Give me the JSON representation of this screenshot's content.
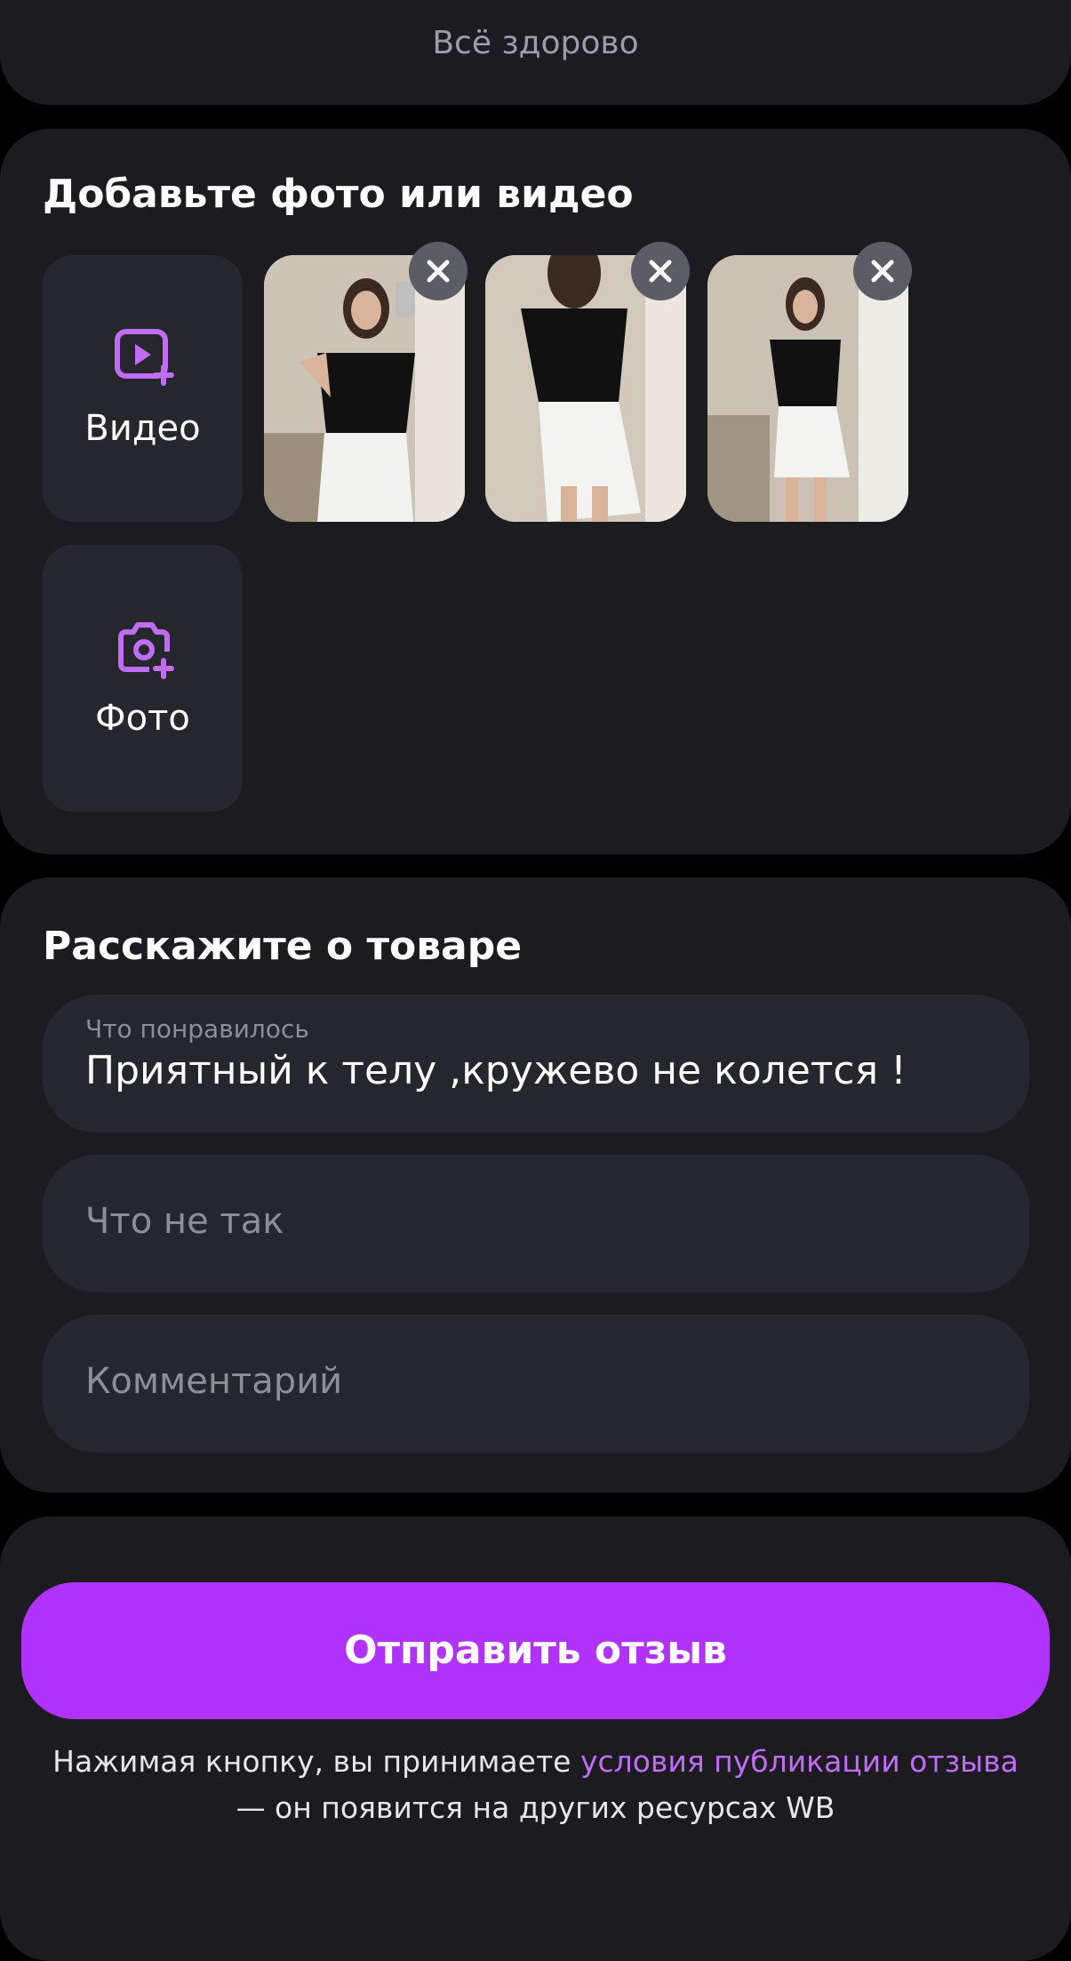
{
  "top_card": {
    "text": "Всё здорово"
  },
  "media_section": {
    "title": "Добавьте фото или видео",
    "add_video_label": "Видео",
    "add_photo_label": "Фото",
    "photos": [
      {
        "alt": "photo-1"
      },
      {
        "alt": "photo-2"
      },
      {
        "alt": "photo-3"
      }
    ]
  },
  "review_section": {
    "title": "Расскажите о товаре",
    "liked_label": "Что понравилось",
    "liked_value": "Приятный к телу ,кружево не колется !",
    "wrong_placeholder": "Что не так",
    "comment_placeholder": "Комментарий"
  },
  "submit": {
    "label": "Отправить отзыв"
  },
  "disclaimer": {
    "prefix": "Нажимая кнопку, вы принимаете ",
    "link": "условия публикации отзыва",
    "suffix": "— он появится на других ресурсах WB"
  },
  "colors": {
    "accent": "#b133fb",
    "link": "#c06cf5",
    "card": "#1b1b20",
    "field": "#26262d",
    "background": "#000000"
  },
  "icons": [
    "video-add-icon",
    "camera-add-icon",
    "close-icon"
  ]
}
